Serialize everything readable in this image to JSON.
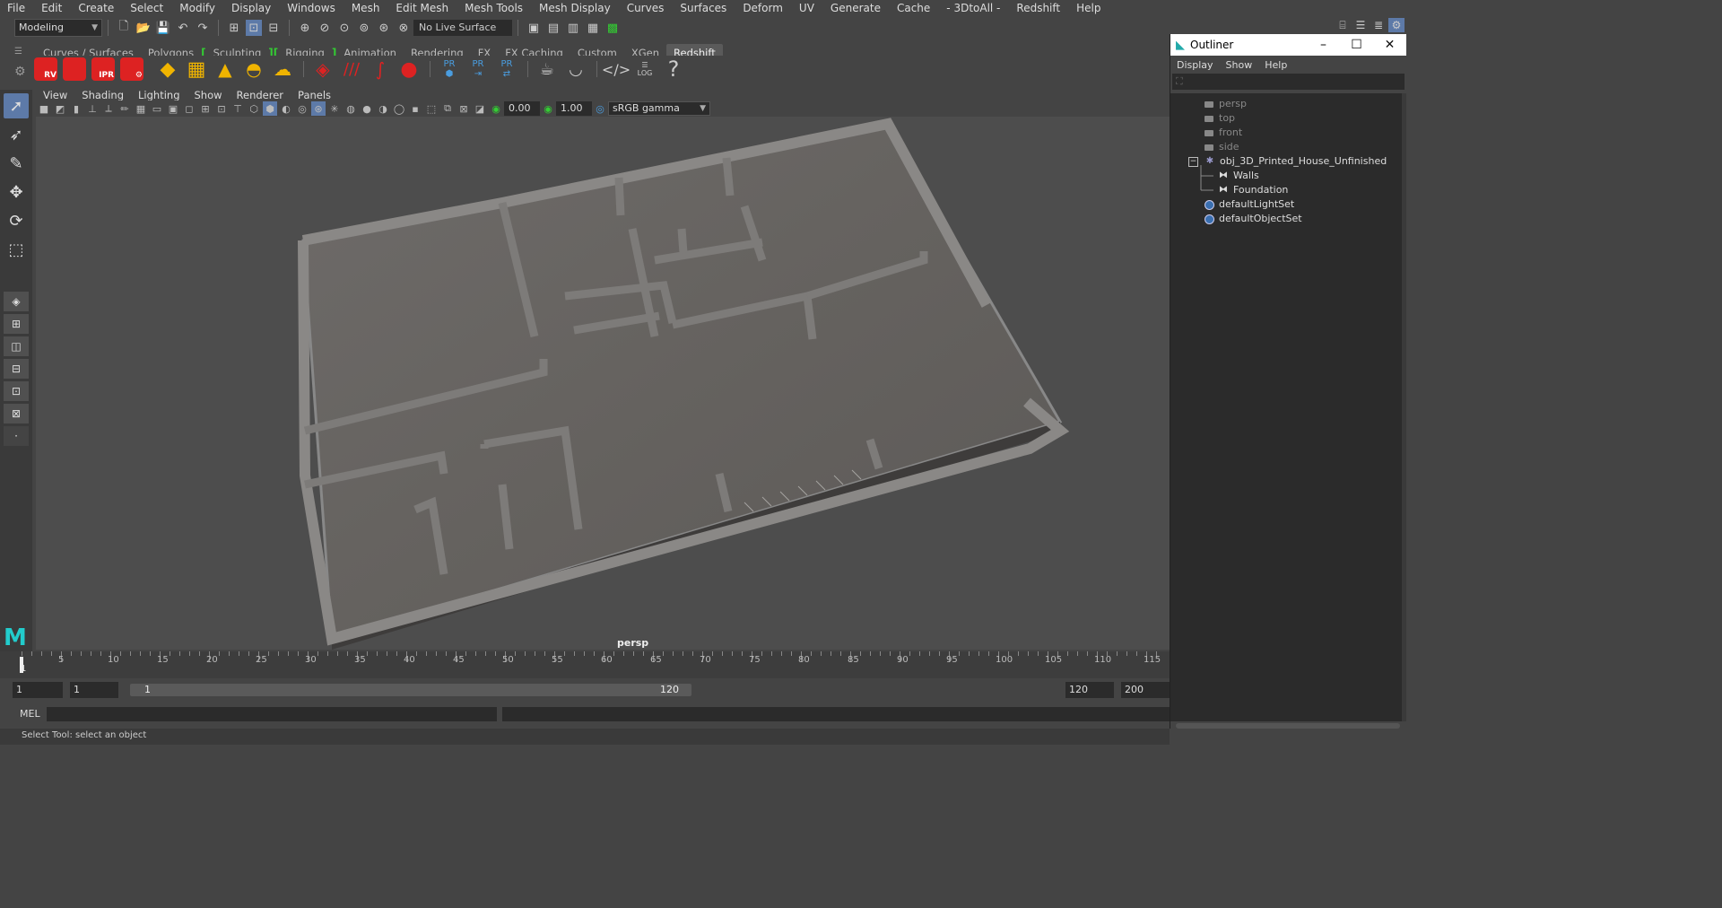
{
  "menubar": {
    "items": [
      "File",
      "Edit",
      "Create",
      "Select",
      "Modify",
      "Display",
      "Windows",
      "Mesh",
      "Edit Mesh",
      "Mesh Tools",
      "Mesh Display",
      "Curves",
      "Surfaces",
      "Deform",
      "UV",
      "Generate",
      "Cache",
      "- 3DtoAll -",
      "Redshift",
      "Help"
    ]
  },
  "statusline": {
    "workspace": "Modeling",
    "live_surface": "No Live Surface"
  },
  "shelf": {
    "tabs": [
      "Curves / Surfaces",
      "Polygons",
      "Sculpting",
      "Rigging",
      "Animation",
      "Rendering",
      "FX",
      "FX Caching",
      "Custom",
      "XGen",
      "Redshift"
    ],
    "active_tab": "Redshift",
    "icon_labels": {
      "rv": "RV",
      "ipr": "IPR",
      "pr": "PR",
      "log": "LOG",
      "help": "?"
    }
  },
  "viewport": {
    "menu": [
      "View",
      "Shading",
      "Lighting",
      "Show",
      "Renderer",
      "Panels"
    ],
    "exposure": "0.00",
    "gamma": "1.00",
    "color_space": "sRGB gamma",
    "camera_label": "persp"
  },
  "timeline": {
    "ticks": [
      "5",
      "10",
      "15",
      "20",
      "25",
      "30",
      "35",
      "40",
      "45",
      "50",
      "55",
      "60",
      "65",
      "70",
      "75",
      "80",
      "85",
      "90",
      "95",
      "100",
      "105",
      "110",
      "115"
    ],
    "current": "1"
  },
  "range": {
    "start": "1",
    "playback_start": "1",
    "slider_start": "1",
    "slider_end": "120",
    "playback_end": "120",
    "end": "200"
  },
  "mel": {
    "label": "MEL"
  },
  "status": {
    "text": "Select Tool: select an object"
  },
  "outliner": {
    "title": "Outliner",
    "menu": [
      "Display",
      "Show",
      "Help"
    ],
    "items": [
      {
        "label": "persp",
        "dim": true
      },
      {
        "label": "top",
        "dim": true
      },
      {
        "label": "front",
        "dim": true
      },
      {
        "label": "side",
        "dim": true
      },
      {
        "label": "obj_3D_Printed_House_Unfinished",
        "dim": false
      },
      {
        "label": "Walls",
        "dim": false
      },
      {
        "label": "Foundation",
        "dim": false
      },
      {
        "label": "defaultLightSet",
        "dim": false
      },
      {
        "label": "defaultObjectSet",
        "dim": false
      }
    ],
    "expander": "−"
  },
  "colors": {
    "accent": "#5d7aa8",
    "shelf_bracket": "#33cc33",
    "redshift_red": "#dd2222",
    "bg": "#444444"
  }
}
